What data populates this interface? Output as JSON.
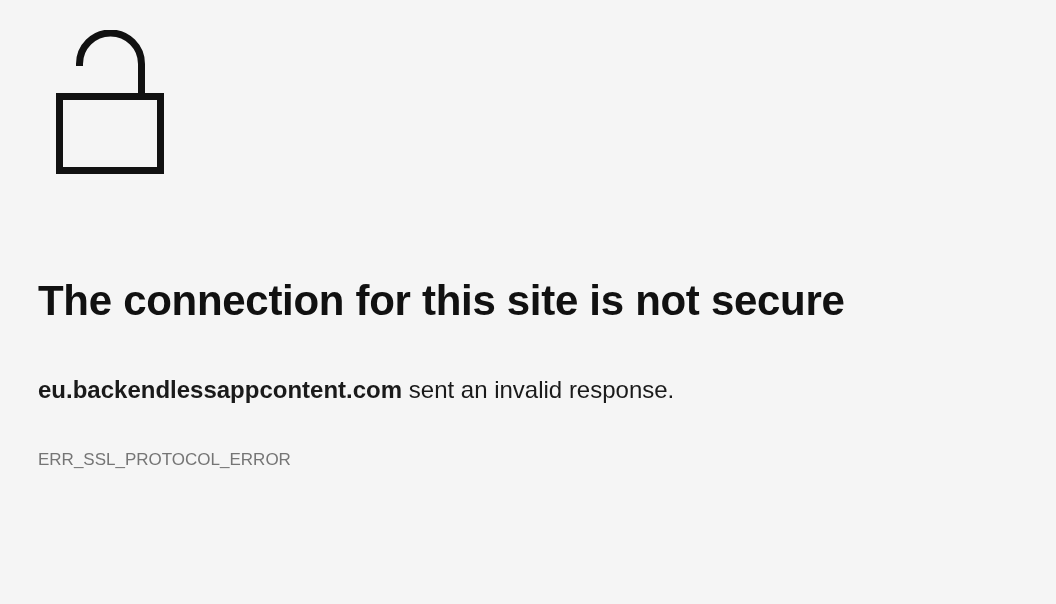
{
  "heading": "The connection for this site is not secure",
  "message": "**eu.backendlessappcontent.com** sent an invalid response.",
  "error_code": "ERR_SSL_PROTOCOL_ERROR"
}
